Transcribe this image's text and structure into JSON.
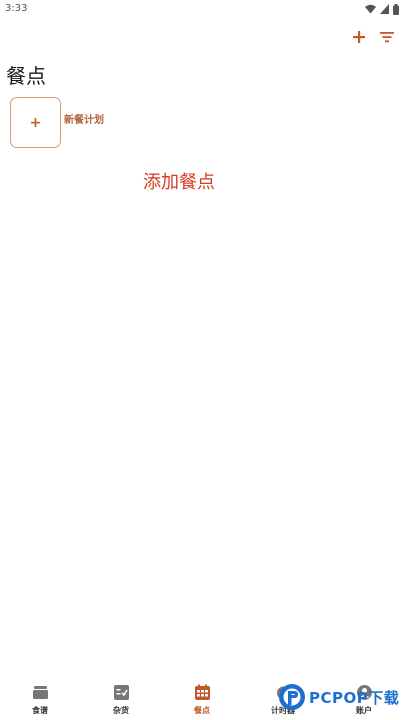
{
  "status_bar": {
    "time": "3:33",
    "icons": [
      "wifi-icon",
      "signal-icon",
      "battery-icon"
    ]
  },
  "app_bar": {
    "actions": [
      "add-icon",
      "filter-icon"
    ]
  },
  "page": {
    "title": "餐点"
  },
  "meal_plan": {
    "new_plan_label": "新餐计划",
    "add_symbol": "+"
  },
  "add_meal_link": "添加餐点",
  "bottom_nav": {
    "items": [
      {
        "label": "食谱",
        "icon": "recipes-icon"
      },
      {
        "label": "杂货",
        "icon": "groceries-icon"
      },
      {
        "label": "餐点",
        "icon": "calendar-icon",
        "active": true
      },
      {
        "label": "计时器",
        "icon": "timer-icon"
      },
      {
        "label": "账户",
        "icon": "account-icon"
      }
    ]
  },
  "watermark": {
    "text": "PCPOP下载"
  },
  "colors": {
    "accent": "#c5572a",
    "link": "#d63a22",
    "tile_border": "#d99a7a"
  }
}
